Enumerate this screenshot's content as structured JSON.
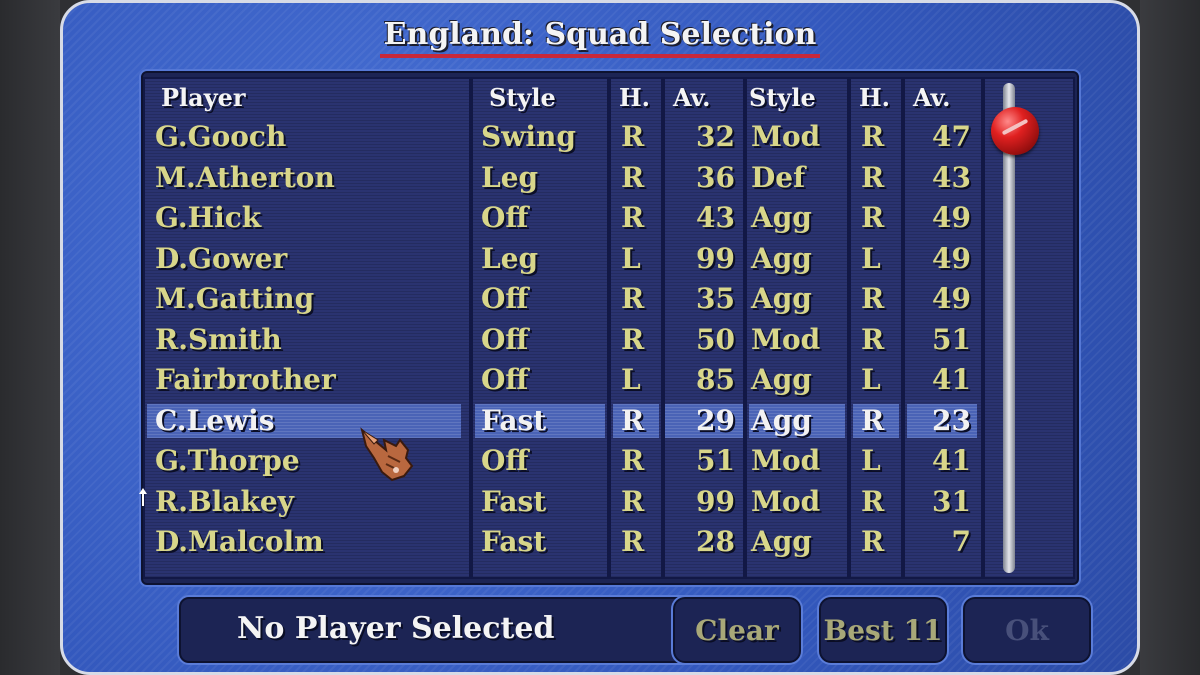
{
  "title": "England: Squad Selection",
  "headers": {
    "player": "Player",
    "bat_style": "Style",
    "bat_hand": "H.",
    "bat_av": "Av.",
    "bowl_style": "Style",
    "bowl_hand": "H.",
    "bowl_av": "Av."
  },
  "rows": [
    {
      "player": "G.Gooch",
      "bat_style": "Swing",
      "bat_hand": "R",
      "bat_av": "32",
      "bowl_style": "Mod",
      "bowl_hand": "R",
      "bowl_av": "47"
    },
    {
      "player": "M.Atherton",
      "bat_style": "Leg",
      "bat_hand": "R",
      "bat_av": "36",
      "bowl_style": "Def",
      "bowl_hand": "R",
      "bowl_av": "43"
    },
    {
      "player": "G.Hick",
      "bat_style": "Off",
      "bat_hand": "R",
      "bat_av": "43",
      "bowl_style": "Agg",
      "bowl_hand": "R",
      "bowl_av": "49"
    },
    {
      "player": "D.Gower",
      "bat_style": "Leg",
      "bat_hand": "L",
      "bat_av": "99",
      "bowl_style": "Agg",
      "bowl_hand": "L",
      "bowl_av": "49"
    },
    {
      "player": "M.Gatting",
      "bat_style": "Off",
      "bat_hand": "R",
      "bat_av": "35",
      "bowl_style": "Agg",
      "bowl_hand": "R",
      "bowl_av": "49"
    },
    {
      "player": "R.Smith",
      "bat_style": "Off",
      "bat_hand": "R",
      "bat_av": "50",
      "bowl_style": "Mod",
      "bowl_hand": "R",
      "bowl_av": "51"
    },
    {
      "player": "Fairbrother",
      "bat_style": "Off",
      "bat_hand": "L",
      "bat_av": "85",
      "bowl_style": "Agg",
      "bowl_hand": "L",
      "bowl_av": "41"
    },
    {
      "player": "C.Lewis",
      "bat_style": "Fast",
      "bat_hand": "R",
      "bat_av": "29",
      "bowl_style": "Agg",
      "bowl_hand": "R",
      "bowl_av": "23"
    },
    {
      "player": "G.Thorpe",
      "bat_style": "Off",
      "bat_hand": "R",
      "bat_av": "51",
      "bowl_style": "Mod",
      "bowl_hand": "L",
      "bowl_av": "41"
    },
    {
      "player": "R.Blakey",
      "bat_style": "Fast",
      "bat_hand": "R",
      "bat_av": "99",
      "bowl_style": "Mod",
      "bowl_hand": "R",
      "bowl_av": "31"
    },
    {
      "player": "D.Malcolm",
      "bat_style": "Fast",
      "bat_hand": "R",
      "bat_av": "28",
      "bowl_style": "Agg",
      "bowl_hand": "R",
      "bowl_av": "7"
    }
  ],
  "selected_row": 7,
  "status": "No Player Selected",
  "buttons": {
    "clear": "Clear",
    "best11": "Best 11",
    "ok": "Ok"
  },
  "icons": {
    "scroll_handle": "red-ball-icon",
    "pointer": "hand-pointer-icon"
  },
  "colors": {
    "background": "#3b62c8",
    "panel": "#1c2454",
    "text_yellow": "#d8d68a",
    "selected_text": "#f2f2f2",
    "title_underline": "#c8283a"
  }
}
